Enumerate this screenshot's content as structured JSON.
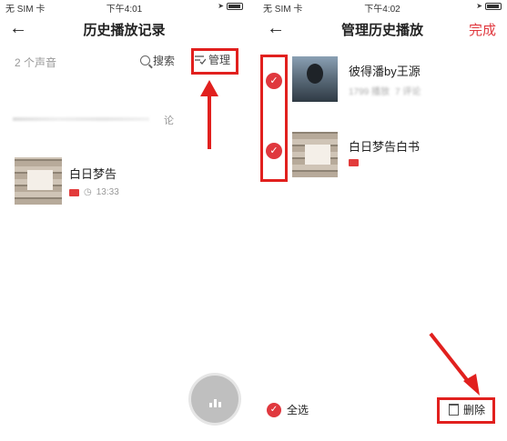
{
  "left": {
    "status": {
      "carrier": "无 SIM 卡 ",
      "time": "下午4:01"
    },
    "title": "历史播放记录",
    "count": "2 个声音",
    "search_label": "搜索",
    "manage_label": "管理",
    "blurred_suffix": "论",
    "item": {
      "title": "白日梦告",
      "time": "13:33"
    }
  },
  "right": {
    "status": {
      "carrier": "无 SIM 卡 ",
      "time": "下午4:02"
    },
    "title": "管理历史播放",
    "done_label": "完成",
    "items": [
      {
        "title": "彼得潘by王源",
        "meta_plays": "1799 播放",
        "meta_comments": "7 评论"
      },
      {
        "title": "白日梦告白书"
      }
    ],
    "select_all_label": "全选",
    "delete_label": "删除"
  },
  "colors": {
    "accent": "#e0383e",
    "annotation": "#e1201e"
  }
}
